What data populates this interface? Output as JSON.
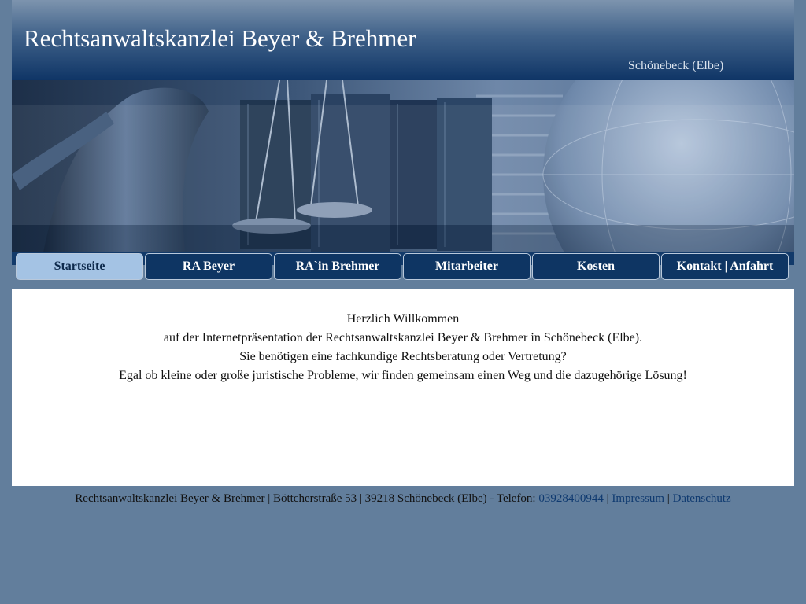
{
  "header": {
    "title": "Rechtsanwaltskanzlei Beyer & Brehmer",
    "location": "Schönebeck (Elbe)"
  },
  "nav": {
    "items": [
      {
        "label": "Startseite",
        "active": true
      },
      {
        "label": "RA Beyer",
        "active": false
      },
      {
        "label": "RA`in Brehmer",
        "active": false
      },
      {
        "label": "Mitarbeiter",
        "active": false
      },
      {
        "label": "Kosten",
        "active": false
      },
      {
        "label": "Kontakt | Anfahrt",
        "active": false
      }
    ]
  },
  "content": {
    "lines": [
      "Herzlich Willkommen",
      "auf der Internetpräsentation der Rechtsanwaltskanzlei Beyer & Brehmer in Schönebeck (Elbe).",
      "Sie benötigen eine fachkundige Rechtsberatung oder Vertretung?",
      "Egal ob kleine oder große juristische Probleme, wir finden gemeinsam einen Weg und die dazugehörige Lösung!"
    ]
  },
  "footer": {
    "address": "Rechtsanwaltskanzlei Beyer & Brehmer | Böttcherstraße 53 | 39218 Schönebeck (Elbe) - Telefon:",
    "phone": "03928400944",
    "separator": "|",
    "impressum": "Impressum",
    "datenschutz": "Datenschutz"
  },
  "colors": {
    "page_background": "#627e9c",
    "header_dark": "#0f3566",
    "nav_active": "#a4c3e4",
    "nav_default": "#0e3563"
  }
}
